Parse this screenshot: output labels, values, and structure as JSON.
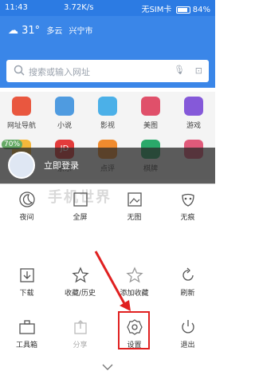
{
  "status": {
    "time": "11:43",
    "speed": "3.72K/s",
    "carrier": "无SIM卡",
    "battery": "84%"
  },
  "header": {
    "temp": "31°",
    "weather": "多云",
    "city": "兴宁市",
    "search_placeholder": "搜索或输入网址"
  },
  "grid": [
    {
      "label": "网址导航",
      "color": "#e9573f"
    },
    {
      "label": "小说",
      "color": "#4f9be0"
    },
    {
      "label": "影视",
      "color": "#4bb0e8"
    },
    {
      "label": "美图",
      "color": "#e0506a"
    },
    {
      "label": "游戏",
      "color": "#8559d9"
    },
    {
      "label": "",
      "color": "#f5b73b"
    },
    {
      "label": "京东",
      "color": "#e23b3b"
    },
    {
      "label": "点评",
      "color": "#f08b2e"
    },
    {
      "label": "棋牌",
      "color": "#2aa96a"
    },
    {
      "label": "",
      "color": "#e05a7a"
    }
  ],
  "badge": "70%",
  "login": "立即登录",
  "menu": {
    "row1": [
      "夜间",
      "全屏",
      "无图",
      "无痕"
    ],
    "row2": [
      "下载",
      "收藏/历史",
      "添加收藏",
      "刷新"
    ],
    "row3": [
      "工具箱",
      "分享",
      "设置",
      "退出"
    ]
  },
  "watermark": "手机世界"
}
